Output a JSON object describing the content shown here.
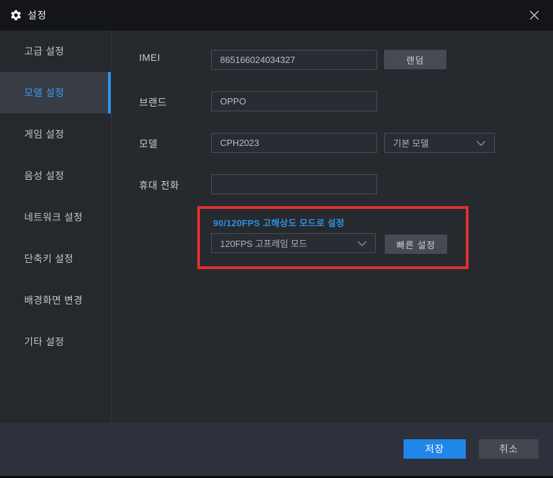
{
  "window": {
    "title": "설정"
  },
  "sidebar": {
    "items": [
      {
        "label": "고급 설정",
        "selected": false
      },
      {
        "label": "모델 설정",
        "selected": true
      },
      {
        "label": "게임 설정",
        "selected": false
      },
      {
        "label": "음성 설정",
        "selected": false
      },
      {
        "label": "네트워크 설정",
        "selected": false
      },
      {
        "label": "단축키 설정",
        "selected": false
      },
      {
        "label": "배경화면 변경",
        "selected": false
      },
      {
        "label": "기타 설정",
        "selected": false
      }
    ]
  },
  "form": {
    "imei": {
      "label": "IMEI",
      "value": "865166024034327",
      "random_button": "랜덤"
    },
    "brand": {
      "label": "브랜드",
      "value": "OPPO"
    },
    "model": {
      "label": "모델",
      "value": "CPH2023",
      "preset_dropdown": "기본 모델"
    },
    "phone": {
      "label": "휴대 전화",
      "value": ""
    },
    "fps": {
      "heading_link": "90/120FPS 고해상도 모드로 설정",
      "dropdown_value": "120FPS 고프레임 모드",
      "quick_button": "빠른 설정"
    }
  },
  "footer": {
    "save_label": "저장",
    "cancel_label": "취소"
  },
  "colors": {
    "accent_blue": "#2b95f0",
    "selected_text_blue": "#3f9df2",
    "link_blue": "#2e8fe0",
    "save_button_blue": "#1f87e8",
    "annotation_red": "#e12f2f",
    "titlebar_bg": "#131519",
    "panel_bg": "#26292e",
    "footer_bg": "#2d313b"
  }
}
